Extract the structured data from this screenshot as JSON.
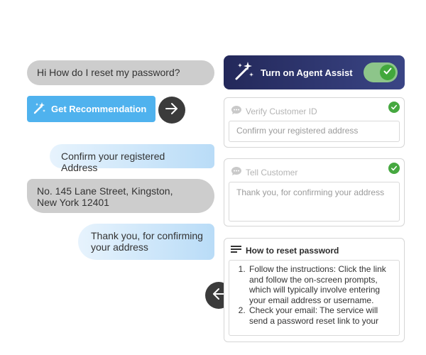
{
  "chat": {
    "msg_customer_1": "Hi How do I reset my password?",
    "msg_agent_1": "Confirm your registered Address",
    "msg_customer_2": "No. 145 Lane Street, Kingston, New York 12401",
    "msg_agent_2": "Thank you, for confirming your address",
    "get_recommendation_label": "Get Recommendation"
  },
  "agent_assist": {
    "label": "Turn on Agent Assist",
    "enabled": true
  },
  "panels": {
    "verify": {
      "title": "Verify Customer ID",
      "value": "Confirm your registered address",
      "status": "complete"
    },
    "tell": {
      "title": "Tell Customer",
      "value": "Thank you, for confirming your address",
      "status": "complete"
    },
    "howto": {
      "title": "How to reset password",
      "steps": [
        "Follow the instructions: Click the link and follow the on-screen prompts, which will typically involve entering your email address or username.",
        "Check your email: The service will send a password reset link to your"
      ]
    }
  },
  "colors": {
    "accent_blue": "#4fb2ee",
    "header_dark": "#23285a",
    "success_green": "#46a840"
  }
}
